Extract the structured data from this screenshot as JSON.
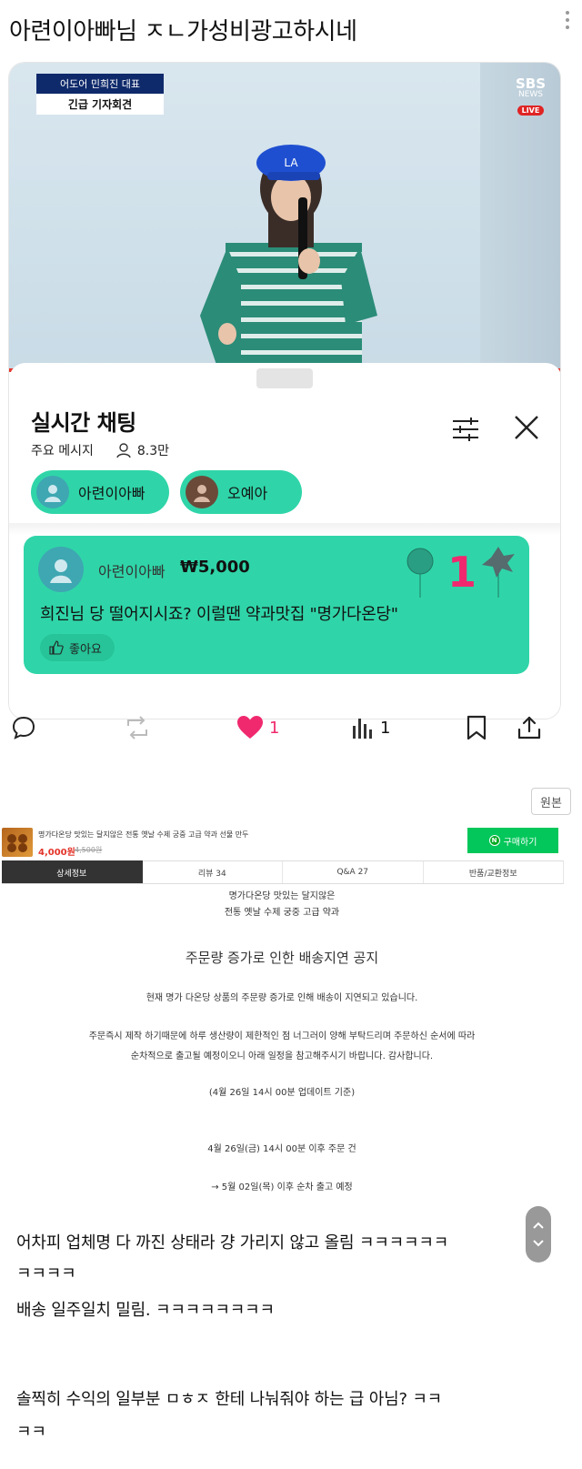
{
  "post": {
    "title": "아련이아빠님 ㅈㄴ가성비광고하시네"
  },
  "video": {
    "banner_line1": "어도어 민희진 대표",
    "banner_line2": "긴급 기자회견",
    "logo_sbs": "SBS",
    "logo_news": "NEWS",
    "logo_live": "LIVE"
  },
  "chat": {
    "title": "실시간 채팅",
    "meta_label": "주요 메시지",
    "viewer_count": "8.3만",
    "chips": [
      {
        "name": "아련이아빠"
      },
      {
        "name": "오예아"
      }
    ],
    "donation": {
      "user": "아련이아빠",
      "amount": "₩5,000",
      "message": "희진님 당 떨어지시죠? 이럴땐 약과맛집 \"명가다온당\"",
      "like_label": "좋아요"
    }
  },
  "actions": {
    "like_count": "1",
    "views_count": "1"
  },
  "original_button": "원본",
  "product": {
    "name": "명가다온당 맛있는 달지않은 전통 옛날 수제 궁중 고급 약과 선물 만두",
    "price": "4,000원",
    "old_price": "4,500원",
    "buy_label": "구매하기",
    "tabs": [
      "상세정보",
      "리뷰 34",
      "Q&A 27",
      "반품/교환정보"
    ]
  },
  "notice": {
    "sub1": "명가다온당 맛있는 달지않은",
    "sub2": "전통 옛날 수제 궁중 고급 약과",
    "heading": "주문량 증가로 인한 배송지연 공지",
    "p1": "현재 명가 다온당 상품의 주문량 증가로 인해 배송이 지연되고 있습니다.",
    "p2a": "주문즉시 제작 하기때문에 하루 생산량이 제한적인 점 너그러이 양해 부탁드리며 주문하신 순서에 따라",
    "p2b": "순차적으로 출고될 예정이오니 아래 일정을 참고해주시기 바랍니다. 감사합니다.",
    "updated": "(4월 26일 14시 00분 업데이트 기준)",
    "schedule1": "4월 26일(금) 14시 00분 이후 주문 건",
    "schedule2": "→ 5월 02일(목) 이후 순차 출고 예정"
  },
  "comments": {
    "c1a": "어차피 업체명 다 까진 상태라 걍 가리지 않고 올림 ㅋㅋㅋㅋㅋㅋ",
    "c1b": "ㅋㅋㅋㅋ",
    "c2": "배송 일주일치 밀림. ㅋㅋㅋㅋㅋㅋㅋㅋ",
    "c3a": "솔찍히 수익의 일부분 ㅁㅎㅈ 한테 나눠줘야 하는 급 아님? ㅋㅋ",
    "c3b": "ㅋㅋ"
  },
  "colors": {
    "chat_green": "#2fd5a8",
    "heart": "#f0296e",
    "buy_green": "#03c75a",
    "price_red": "#e4342a"
  }
}
